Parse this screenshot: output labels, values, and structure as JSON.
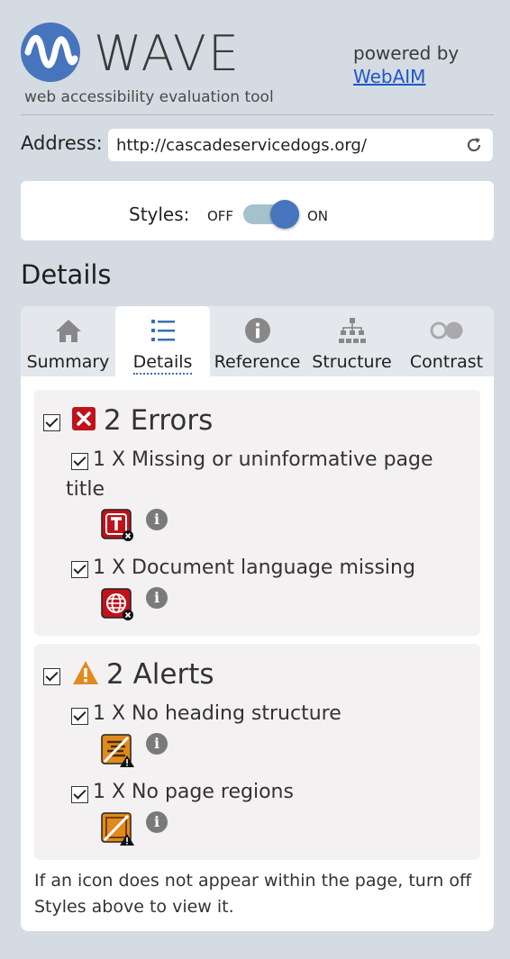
{
  "header": {
    "logo_text": "WAVE",
    "tagline": "web accessibility evaluation tool",
    "powered_by": "powered by",
    "powered_link": "WebAIM"
  },
  "address": {
    "label": "Address:",
    "url": "http://cascadeservicedogs.org/"
  },
  "styles": {
    "label": "Styles:",
    "off": "OFF",
    "on": "ON",
    "state": "on"
  },
  "section_title": "Details",
  "tabs": [
    {
      "label": "Summary",
      "icon": "home-icon",
      "active": false
    },
    {
      "label": "Details",
      "icon": "list-icon",
      "active": true
    },
    {
      "label": "Reference",
      "icon": "info-icon",
      "active": false
    },
    {
      "label": "Structure",
      "icon": "hierarchy-icon",
      "active": false
    },
    {
      "label": "Contrast",
      "icon": "contrast-icon",
      "active": false
    }
  ],
  "errors": {
    "title": "2 Errors",
    "items": [
      {
        "text": "1 X Missing or uninformative page title",
        "icon": "missing-title-error-icon"
      },
      {
        "text": "1 X Document language missing",
        "icon": "language-missing-error-icon"
      }
    ]
  },
  "alerts": {
    "title": "2 Alerts",
    "items": [
      {
        "text": "1 X No heading structure",
        "icon": "no-heading-alert-icon"
      },
      {
        "text": "1 X No page regions",
        "icon": "no-regions-alert-icon"
      }
    ]
  },
  "footnote": "If an icon does not appear within the page, turn off Styles above to view it.",
  "colors": {
    "accent": "#4775bd",
    "error": "#c0121b",
    "alert": "#e08a1e",
    "background": "#d5dbe2"
  }
}
